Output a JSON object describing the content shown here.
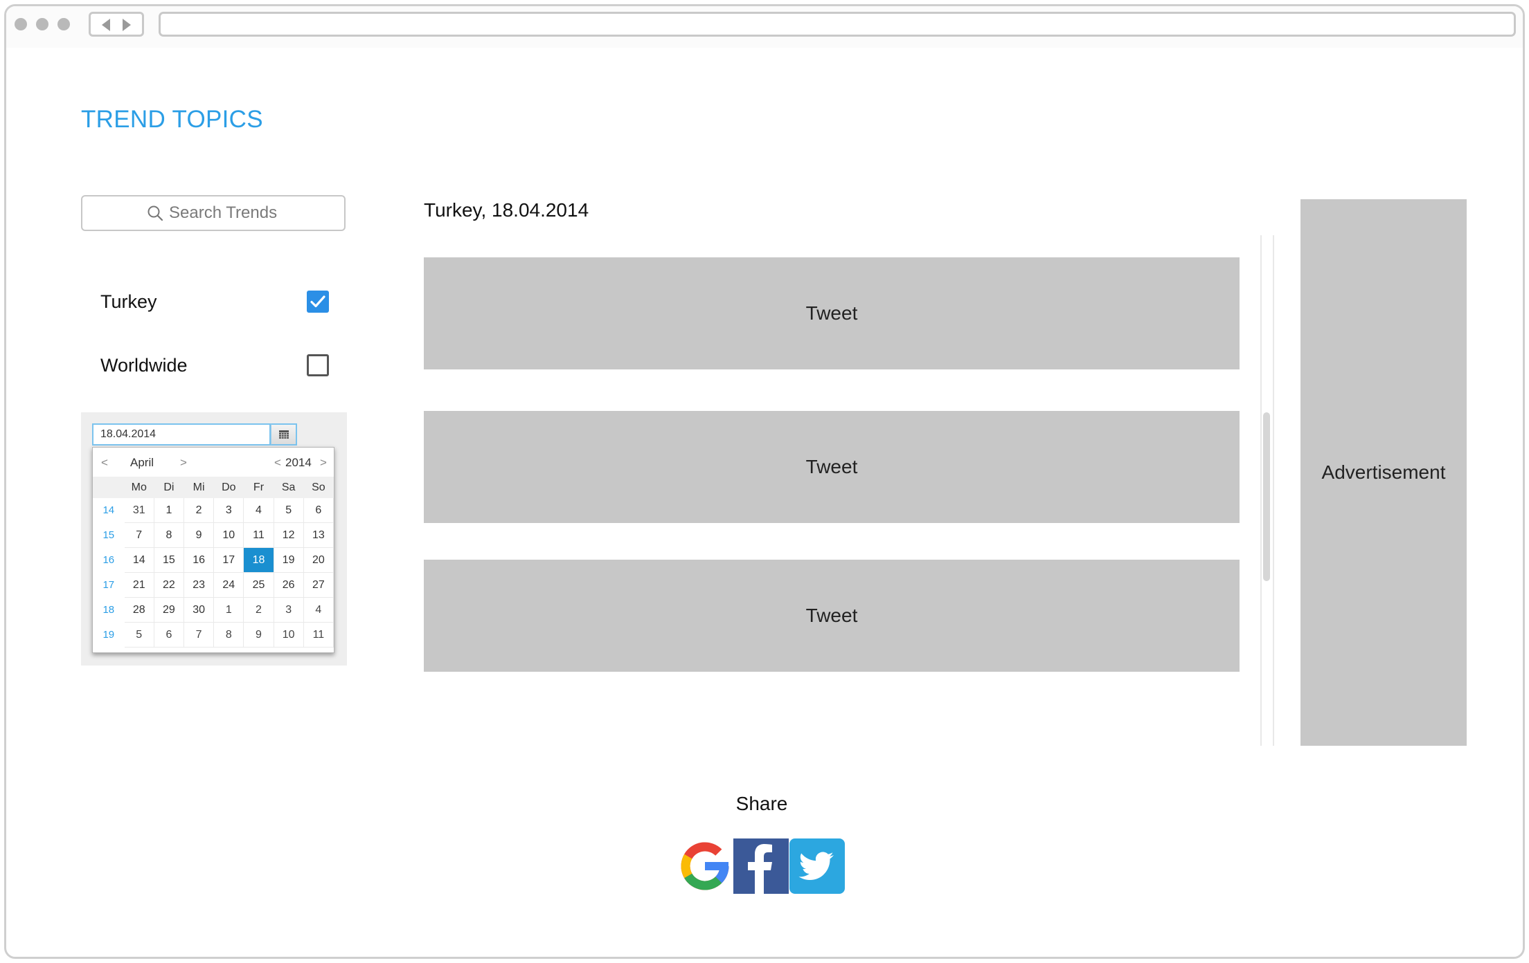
{
  "page": {
    "title": "TREND TOPICS"
  },
  "search": {
    "placeholder": "Search Trends",
    "value": ""
  },
  "filters": [
    {
      "label": "Turkey",
      "checked": true
    },
    {
      "label": "Worldwide",
      "checked": false
    }
  ],
  "datepicker": {
    "value": "18.04.2014",
    "month": "April",
    "year": "2014",
    "prev_arrow": "<",
    "next_arrow": ">",
    "weekdays": [
      "Mo",
      "Di",
      "Mi",
      "Do",
      "Fr",
      "Sa",
      "So"
    ],
    "weeks": [
      {
        "week": "14",
        "days": [
          "31",
          "1",
          "2",
          "3",
          "4",
          "5",
          "6"
        ]
      },
      {
        "week": "15",
        "days": [
          "7",
          "8",
          "9",
          "10",
          "11",
          "12",
          "13"
        ]
      },
      {
        "week": "16",
        "days": [
          "14",
          "15",
          "16",
          "17",
          "18",
          "19",
          "20"
        ]
      },
      {
        "week": "17",
        "days": [
          "21",
          "22",
          "23",
          "24",
          "25",
          "26",
          "27"
        ]
      },
      {
        "week": "18",
        "days": [
          "28",
          "29",
          "30",
          "1",
          "2",
          "3",
          "4"
        ]
      },
      {
        "week": "19",
        "days": [
          "5",
          "6",
          "7",
          "8",
          "9",
          "10",
          "11"
        ]
      }
    ],
    "selected_day": "18",
    "accent_color": "#1a8fd0"
  },
  "feed": {
    "heading": "Turkey, 18.04.2014",
    "tweets": [
      "Tweet",
      "Tweet",
      "Tweet"
    ]
  },
  "advertisement": {
    "label": "Advertisement"
  },
  "share": {
    "label": "Share",
    "icons": [
      "google-icon",
      "facebook-icon",
      "twitter-icon"
    ]
  },
  "colors": {
    "title": "#2b9ee6",
    "checkbox_checked": "#2b8fe6",
    "placeholder_block": "#c7c7c7",
    "facebook": "#3b5998",
    "twitter": "#2ca7e0"
  }
}
